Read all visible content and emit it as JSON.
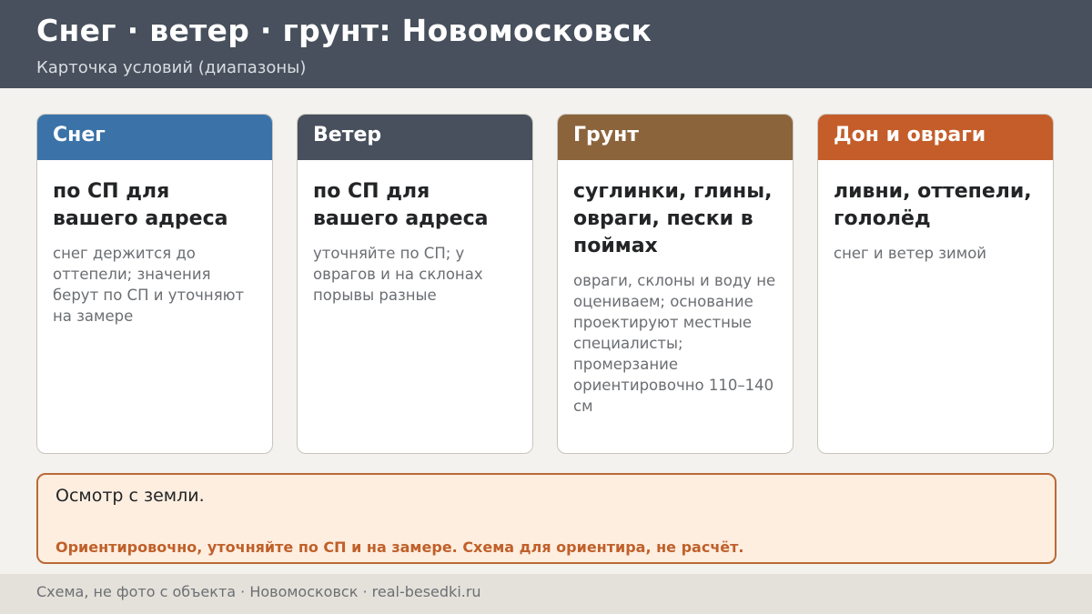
{
  "header": {
    "title": "Снег · ветер · грунт: Новомосковск",
    "subtitle": "Карточка условий (диапазоны)"
  },
  "cards": [
    {
      "heading": "Снег",
      "color": "#3b73a9",
      "main": "по СП для вашего адреса",
      "note": "снег держится до оттепели; значения берут по СП и уточняют на замере"
    },
    {
      "heading": "Ветер",
      "color": "#47505c",
      "main": "по СП для вашего адреса",
      "note": "уточняйте по СП; у оврагов и на склонах порывы разные"
    },
    {
      "heading": "Грунт",
      "color": "#8b643c",
      "main": "суглинки, глины, овраги, пески в поймах",
      "note": "овраги, склоны и воду не оцениваем; основание проектируют местные специалисты; промерзание ориентировочно 110–140 см"
    },
    {
      "heading": "Дон и овраги",
      "color": "#c45d29",
      "main": "ливни, оттепели, гололёд",
      "note": "снег и ветер зимой"
    }
  ],
  "callout": {
    "text": "Осмотр с земли.",
    "warning": "Ориентировочно, уточняйте по СП и на замере. Схема для ориентира, не расчёт."
  },
  "footer": {
    "text": "Схема, не фото с объекта  ·  Новомосковск  ·  real-besedki.ru"
  }
}
